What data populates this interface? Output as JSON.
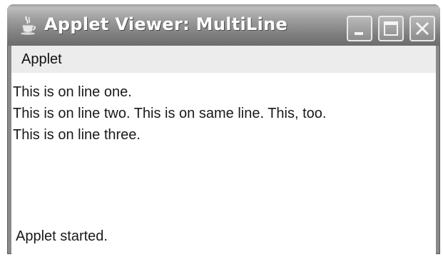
{
  "window": {
    "title": "Applet Viewer: MultiLine",
    "app_icon": "java-cup-icon",
    "buttons": [
      "minimize-icon",
      "maximize-icon",
      "close-icon"
    ]
  },
  "menu": {
    "items": [
      {
        "label": "Applet"
      }
    ]
  },
  "applet": {
    "lines": [
      "This is on line one.",
      "This is on line two. This is on same line. This, too.",
      "This is on line three."
    ]
  },
  "status": {
    "text": "Applet started."
  }
}
